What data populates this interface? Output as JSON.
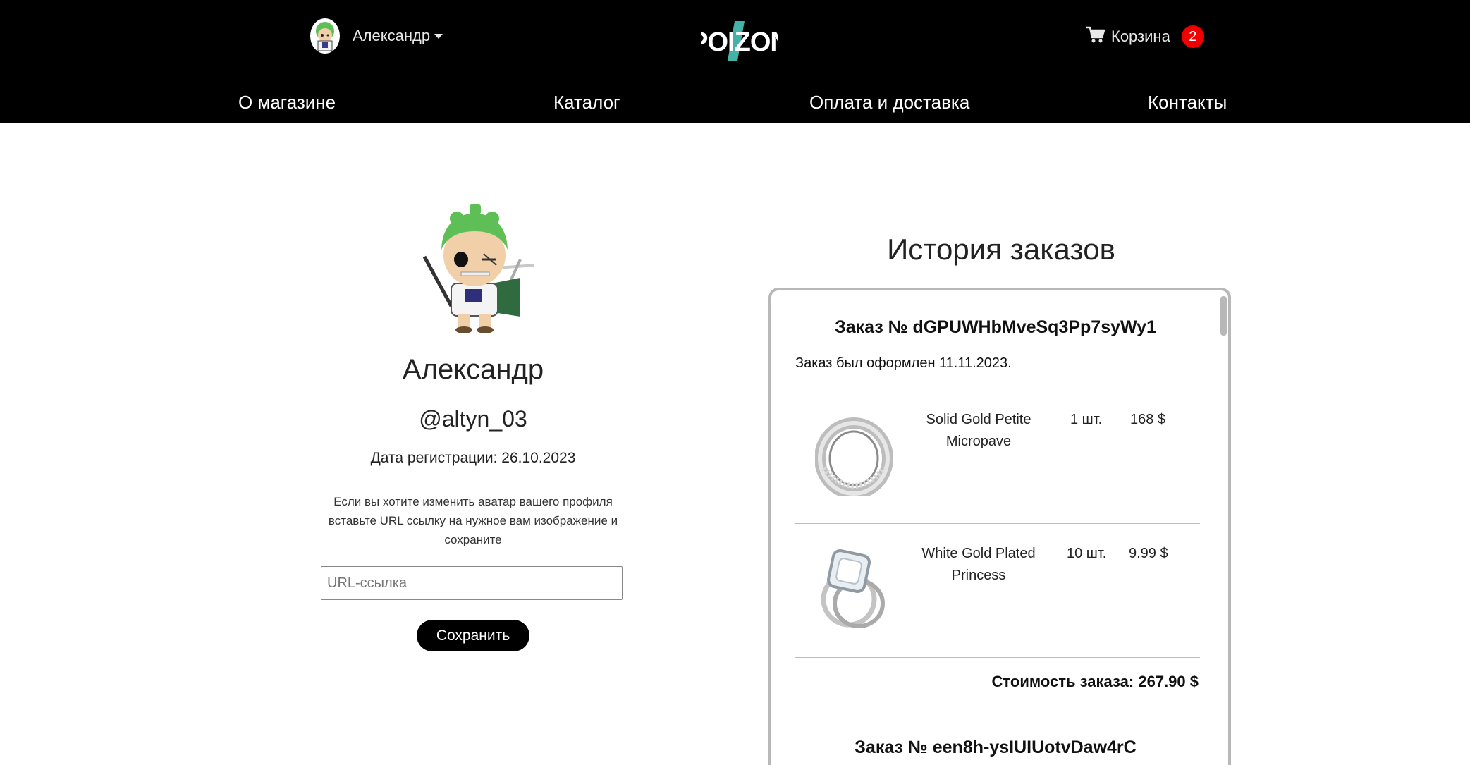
{
  "header": {
    "user_name": "Александр",
    "logo_text": "POIZON",
    "cart_label": "Корзина",
    "cart_count": "2",
    "accent_color": "#e00000"
  },
  "nav": {
    "about": "О магазине",
    "catalog": "Каталог",
    "delivery": "Оплата и доставка",
    "contacts": "Контакты"
  },
  "profile": {
    "name": "Александр",
    "handle": "@altyn_03",
    "registration": "Дата регистрации: 26.10.2023",
    "hint": "Если вы хотите изменить аватар вашего профиля вставьте URL ссылку на нужное вам изображение и сохраните",
    "url_placeholder": "URL-ссылка",
    "save_label": "Сохранить"
  },
  "orders": {
    "title": "История заказов",
    "list": [
      {
        "title": "Заказ № dGPUWHbMveSq3Pp7syWy1",
        "date": "Заказ был оформлен 11.11.2023.",
        "items": [
          {
            "name": "Solid Gold Petite Micropave",
            "qty": "1 шт.",
            "price": "168 $",
            "icon": "ring-band-icon"
          },
          {
            "name": "White Gold Plated Princess",
            "qty": "10 шт.",
            "price": "9.99 $",
            "icon": "ring-diamond-icon"
          }
        ],
        "total": "Стоимость заказа: 267.90 $"
      },
      {
        "title": "Заказ № een8h-ysIUIUotvDaw4rC"
      }
    ]
  }
}
